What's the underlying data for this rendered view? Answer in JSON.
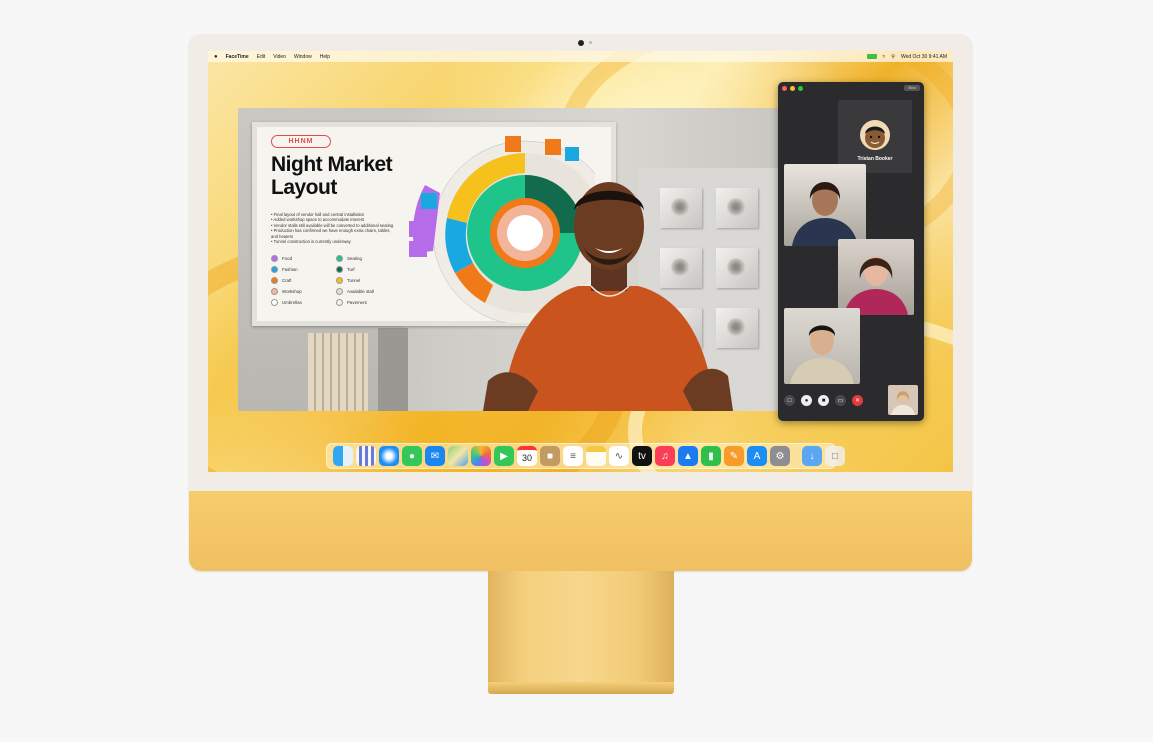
{
  "menubar": {
    "apple": "",
    "app_name": "FaceTime",
    "items": [
      "Edit",
      "Video",
      "Window",
      "Help"
    ],
    "clock": "Wed Oct 30  9:41 AM"
  },
  "poster": {
    "logo": "HHNM",
    "title_line1": "Night Market",
    "title_line2": "Layout",
    "bullets": [
      "Final layout of vendor hall and central installation",
      "Added workshop space to accommodate interest",
      "Vendor stalls still available will be converted to additional seating",
      "Production has confirmed we have enough extra chairs, tables, and heaters",
      "Tunnel construction is currently underway"
    ],
    "legend": [
      {
        "label": "Food",
        "color": "#b66be8"
      },
      {
        "label": "Seating",
        "color": "#1fc48a"
      },
      {
        "label": "Fashion",
        "color": "#1aa8e0"
      },
      {
        "label": "Turf",
        "color": "#136b4d"
      },
      {
        "label": "Craft",
        "color": "#f07a1a"
      },
      {
        "label": "Tunnel",
        "color": "#f6c01d"
      },
      {
        "label": "Workshop",
        "color": "#f2b59a"
      },
      {
        "label": "Available stall",
        "color": "#e0ddd6"
      },
      {
        "label": "Umbrellas",
        "color": "#ffffff"
      },
      {
        "label": "Pavement",
        "color": "#f3f1ec"
      }
    ]
  },
  "facetime": {
    "end_label": "End",
    "main_caller": "Tristan Booker"
  },
  "dock": {
    "calendar_day": "30",
    "apps": [
      "finder-icon",
      "launchpad-icon",
      "safari-icon",
      "messages-icon",
      "mail-icon",
      "maps-icon",
      "photos-icon",
      "facetime-icon",
      "calendar-icon",
      "contacts-icon",
      "reminders-icon",
      "notes-icon",
      "freeform-icon",
      "tv-icon",
      "music-icon",
      "keynote-icon",
      "numbers-icon",
      "pages-icon",
      "app-store-icon",
      "system-settings-icon",
      "downloads-icon",
      "trash-icon"
    ]
  },
  "colors": {
    "imac_yellow": "#f7cc6a",
    "end_call_red": "#e23b3b"
  }
}
